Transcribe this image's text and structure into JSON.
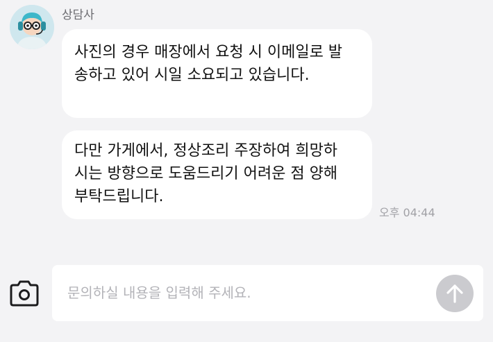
{
  "chat": {
    "sender": "상담사",
    "messages": [
      {
        "lines": [
          "사진의 경우 매장에서 요청 시 이메일로 발",
          "송하고 있어 시일 소요되고 있습니다."
        ]
      },
      {
        "lines": [
          "다만 가게에서, 정상조리 주장하여 희망하",
          "시는 방향으로 도움드리기 어려운 점 양해",
          "부탁드립니다."
        ]
      }
    ],
    "time": "오후 04:44"
  },
  "composer": {
    "placeholder": "문의하실 내용을 입력해 주세요."
  },
  "icons": {
    "avatar": "counselor-avatar",
    "camera": "camera-icon",
    "send": "arrow-up-icon"
  },
  "colors": {
    "background": "#f3f3f5",
    "bubble": "#ffffff",
    "send_button": "#cbcbcf",
    "muted_text": "#a1a1a6"
  }
}
